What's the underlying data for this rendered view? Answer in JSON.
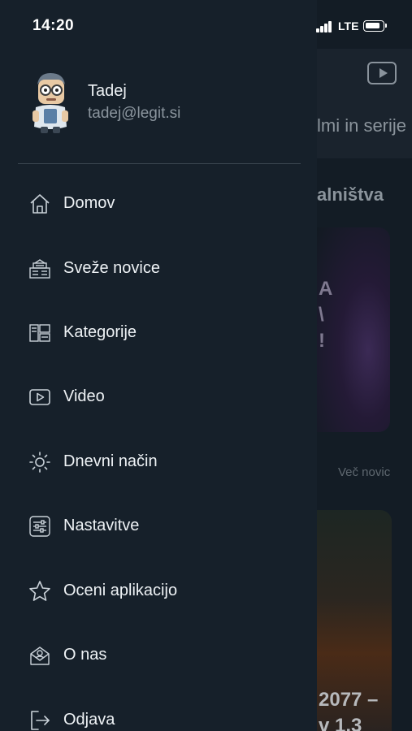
{
  "status_bar": {
    "time": "14:20",
    "network": "LTE"
  },
  "profile": {
    "name": "Tadej",
    "email": "tadej@legit.si"
  },
  "menu": {
    "items": [
      {
        "label": "Domov",
        "icon": "home-icon"
      },
      {
        "label": "Sveže novice",
        "icon": "newspaper-icon"
      },
      {
        "label": "Kategorije",
        "icon": "categories-icon"
      },
      {
        "label": "Video",
        "icon": "video-icon"
      },
      {
        "label": "Dnevni način",
        "icon": "sun-icon"
      },
      {
        "label": "Nastavitve",
        "icon": "settings-sliders-icon"
      },
      {
        "label": "Oceni aplikacijo",
        "icon": "star-icon"
      },
      {
        "label": "O nas",
        "icon": "about-mail-icon"
      },
      {
        "label": "Odjava",
        "icon": "logout-icon"
      }
    ]
  },
  "background": {
    "header_text": "lmi in serije",
    "section_title": "alništva",
    "card1_text_lines": [
      "A",
      "\\",
      "!"
    ],
    "more_link": "Več novic",
    "card2_text_lines": [
      "2077 –",
      "v 1.3"
    ]
  },
  "colors": {
    "drawer_bg": "#16202a",
    "app_bg": "#131c25",
    "text_primary": "#eef2f5",
    "text_secondary": "#8b959e",
    "icon_color": "#c9d1d8"
  }
}
